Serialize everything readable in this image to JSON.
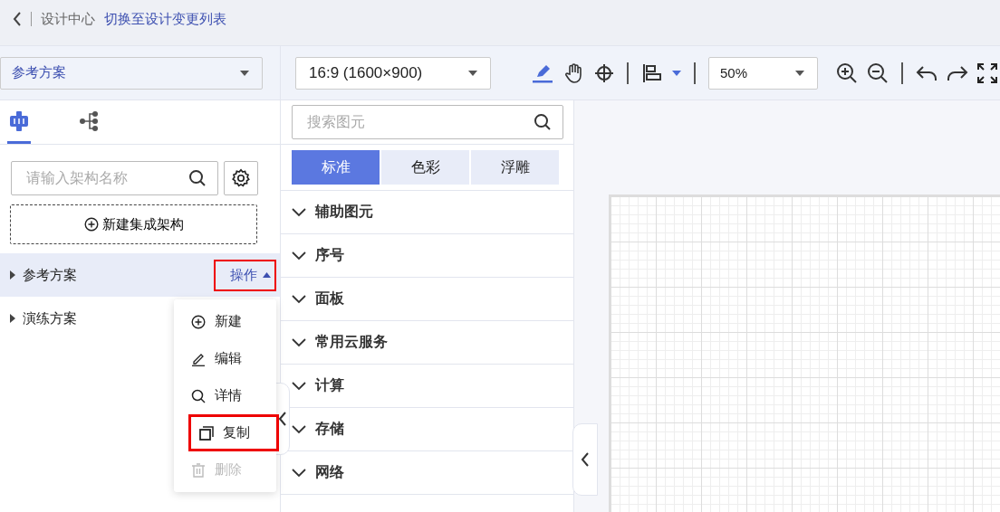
{
  "header": {
    "breadcrumb": "设计中心",
    "link": "切换至设计变更列表"
  },
  "plan_select": {
    "value": "参考方案"
  },
  "toolbar": {
    "ratio": "16:9 (1600×900)",
    "zoom": "50%"
  },
  "left_tabs": [
    {
      "kind": "architecture",
      "selected": true
    },
    {
      "kind": "tree",
      "selected": false
    }
  ],
  "arch_search": {
    "placeholder": "请输入架构名称"
  },
  "new_button": "新建集成架构",
  "tree": [
    {
      "label": "参考方案",
      "selected": true,
      "action": "操作",
      "action_highlighted": true,
      "expanded": true
    },
    {
      "label": "演练方案",
      "selected": false
    }
  ],
  "menu": [
    {
      "kind": "add",
      "label": "新建",
      "disabled": false,
      "highlighted": false
    },
    {
      "kind": "edit",
      "label": "编辑",
      "disabled": false,
      "highlighted": false
    },
    {
      "kind": "detail",
      "label": "详情",
      "disabled": false,
      "highlighted": false
    },
    {
      "kind": "copy",
      "label": "复制",
      "disabled": false,
      "highlighted": true
    },
    {
      "kind": "delete",
      "label": "删除",
      "disabled": true,
      "highlighted": false
    }
  ],
  "palette": {
    "search_placeholder": "搜索图元",
    "tabs": [
      {
        "label": "标准",
        "selected": true
      },
      {
        "label": "色彩",
        "selected": false
      },
      {
        "label": "浮雕",
        "selected": false
      }
    ],
    "categories": [
      "辅助图元",
      "序号",
      "面板",
      "常用云服务",
      "计算",
      "存储",
      "网络"
    ]
  }
}
